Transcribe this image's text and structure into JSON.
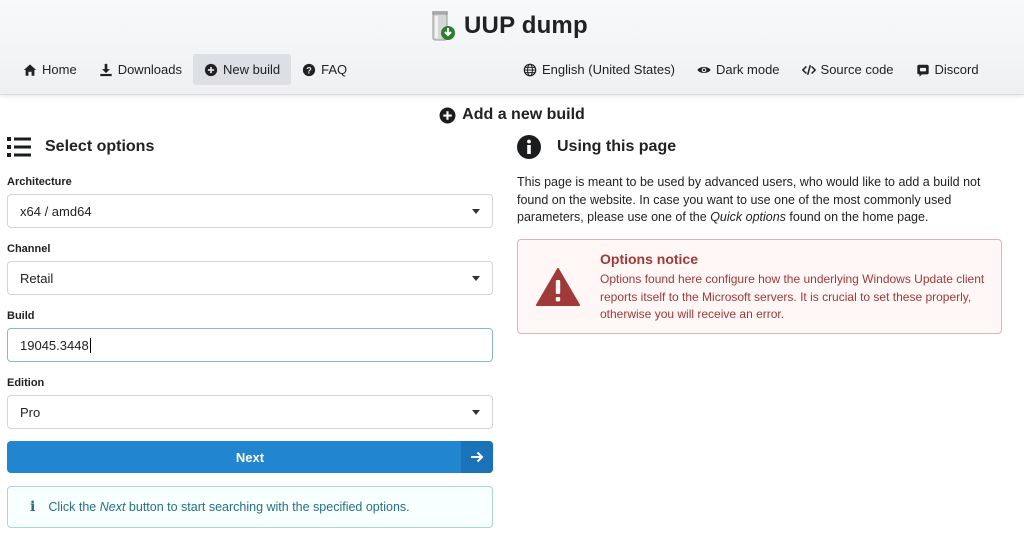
{
  "header": {
    "title": "UUP dump",
    "nav_left": [
      {
        "label": "Home",
        "icon": "home-icon"
      },
      {
        "label": "Downloads",
        "icon": "download-icon"
      },
      {
        "label": "New build",
        "icon": "plus-circle-icon",
        "active": true
      },
      {
        "label": "FAQ",
        "icon": "question-circle-icon"
      }
    ],
    "nav_right": [
      {
        "label": "English (United States)",
        "icon": "globe-icon"
      },
      {
        "label": "Dark mode",
        "icon": "eye-icon"
      },
      {
        "label": "Source code",
        "icon": "code-icon"
      },
      {
        "label": "Discord",
        "icon": "discord-icon"
      }
    ]
  },
  "page_title": "Add a new build",
  "options": {
    "heading": "Select options",
    "architecture": {
      "label": "Architecture",
      "value": "x64 / amd64"
    },
    "channel": {
      "label": "Channel",
      "value": "Retail"
    },
    "build": {
      "label": "Build",
      "value": "19045.3448"
    },
    "edition": {
      "label": "Edition",
      "value": "Pro"
    },
    "next_label": "Next",
    "hint_prefix": "Click the ",
    "hint_em": "Next",
    "hint_suffix": " button to start searching with the specified options."
  },
  "using": {
    "heading": "Using this page",
    "desc_1": "This page is meant to be used by advanced users, who would like to add a build not found on the website. In case you want to use one of the most commonly used parameters, please use one of the ",
    "desc_em": "Quick options",
    "desc_2": " found on the home page.",
    "notice_title": "Options notice",
    "notice_text": "Options found here configure how the underlying Windows Update client reports itself to the Microsoft servers. It is crucial to set these properly, otherwise you will receive an error."
  },
  "colors": {
    "primary": "#2185d0",
    "notice_text": "#9f3a38",
    "notice_bg": "#fff6f6",
    "info_text": "#276f86"
  }
}
